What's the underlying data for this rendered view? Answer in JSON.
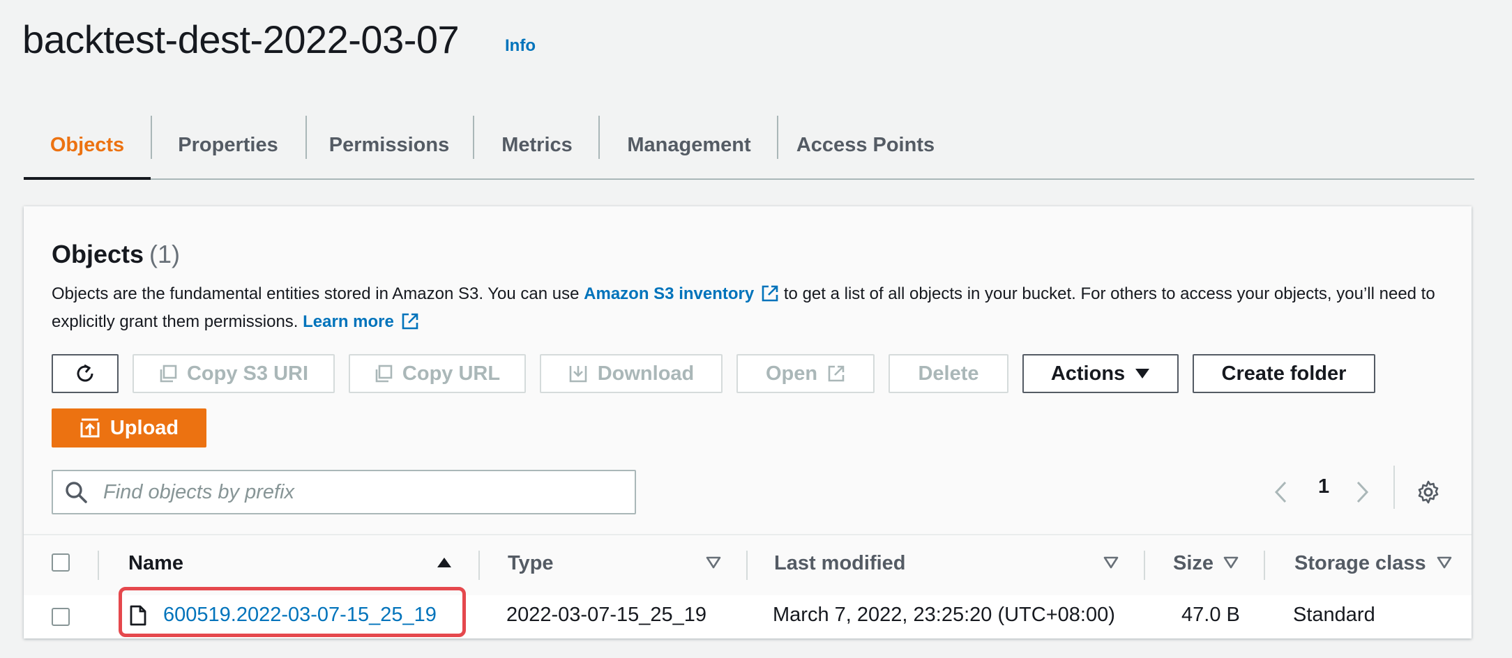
{
  "header": {
    "title": "backtest-dest-2022-03-07",
    "info_link": "Info"
  },
  "tabs": [
    {
      "label": "Objects",
      "active": true
    },
    {
      "label": "Properties",
      "active": false
    },
    {
      "label": "Permissions",
      "active": false
    },
    {
      "label": "Metrics",
      "active": false
    },
    {
      "label": "Management",
      "active": false
    },
    {
      "label": "Access Points",
      "active": false
    }
  ],
  "objects_panel": {
    "heading": "Objects",
    "count": "(1)",
    "description_part1": "Objects are the fundamental entities stored in Amazon S3. You can use ",
    "inventory_link": "Amazon S3 inventory",
    "description_part2": " to get a list of all objects in your bucket. For others to access your objects, you’ll need to explicitly grant them permissions. ",
    "learn_more_link": "Learn more"
  },
  "toolbar": {
    "refresh_icon": "refresh-icon",
    "copy_s3_uri": "Copy S3 URI",
    "copy_url": "Copy URL",
    "download": "Download",
    "open": "Open",
    "delete": "Delete",
    "actions": "Actions",
    "create_folder": "Create folder",
    "upload": "Upload"
  },
  "search": {
    "placeholder": "Find objects by prefix",
    "value": ""
  },
  "pagination": {
    "current_page": "1"
  },
  "table": {
    "columns": [
      "Name",
      "Type",
      "Last modified",
      "Size",
      "Storage class"
    ],
    "rows": [
      {
        "name": "600519.2022-03-07-15_25_19",
        "type": "2022-03-07-15_25_19",
        "last_modified": "March 7, 2022, 23:25:20 (UTC+08:00)",
        "size": "47.0 B",
        "storage_class": "Standard"
      }
    ]
  },
  "colors": {
    "accent": "#ec7211",
    "link": "#0073bb",
    "highlight": "#e5484d",
    "text": "#16191f",
    "muted": "#545b64"
  }
}
